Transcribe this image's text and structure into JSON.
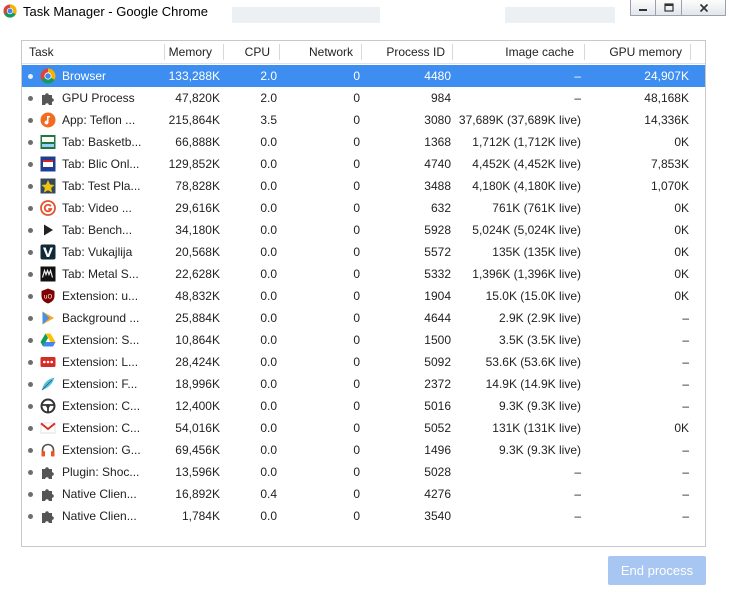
{
  "window": {
    "title": "Task Manager - Google Chrome"
  },
  "columns": [
    "Task",
    "Memory",
    "CPU",
    "Network",
    "Process ID",
    "Image cache",
    "GPU memory"
  ],
  "rows": [
    {
      "icon": "chrome-icon",
      "task": "Browser",
      "memory": "133,288K",
      "cpu": "2.0",
      "network": "0",
      "pid": "4480",
      "image_cache": "–",
      "gpu": "24,907K",
      "selected": true
    },
    {
      "icon": "puzzle-icon",
      "task": "GPU Process",
      "memory": "47,820K",
      "cpu": "2.0",
      "network": "0",
      "pid": "984",
      "image_cache": "–",
      "gpu": "48,168K"
    },
    {
      "icon": "teflon-app-icon",
      "task": "App: Teflon ...",
      "memory": "215,864K",
      "cpu": "3.5",
      "network": "0",
      "pid": "3080",
      "image_cache": "37,689K (37,689K live)",
      "gpu": "14,336K"
    },
    {
      "icon": "basketball-favicon",
      "task": "Tab: Basketb...",
      "memory": "66,888K",
      "cpu": "0.0",
      "network": "0",
      "pid": "1368",
      "image_cache": "1,712K (1,712K live)",
      "gpu": "0K"
    },
    {
      "icon": "blic-favicon",
      "task": "Tab: Blic Onl...",
      "memory": "129,852K",
      "cpu": "0.0",
      "network": "0",
      "pid": "4740",
      "image_cache": "4,452K (4,452K live)",
      "gpu": "7,853K"
    },
    {
      "icon": "test-favicon",
      "task": "Tab: Test Pla...",
      "memory": "78,828K",
      "cpu": "0.0",
      "network": "0",
      "pid": "3488",
      "image_cache": "4,180K (4,180K live)",
      "gpu": "1,070K"
    },
    {
      "icon": "video-favicon",
      "task": "Tab: Video ...",
      "memory": "29,616K",
      "cpu": "0.0",
      "network": "0",
      "pid": "632",
      "image_cache": "761K (761K live)",
      "gpu": "0K"
    },
    {
      "icon": "bench-favicon",
      "task": "Tab: Bench...",
      "memory": "34,180K",
      "cpu": "0.0",
      "network": "0",
      "pid": "5928",
      "image_cache": "5,024K (5,024K live)",
      "gpu": "0K"
    },
    {
      "icon": "vukajlija-favicon",
      "task": "Tab: Vukajlija",
      "memory": "20,568K",
      "cpu": "0.0",
      "network": "0",
      "pid": "5572",
      "image_cache": "135K (135K live)",
      "gpu": "0K"
    },
    {
      "icon": "metal-favicon",
      "task": "Tab: Metal S...",
      "memory": "22,628K",
      "cpu": "0.0",
      "network": "0",
      "pid": "5332",
      "image_cache": "1,396K (1,396K live)",
      "gpu": "0K"
    },
    {
      "icon": "ublock-icon",
      "task": "Extension: u...",
      "memory": "48,832K",
      "cpu": "0.0",
      "network": "0",
      "pid": "1904",
      "image_cache": "15.0K (15.0K live)",
      "gpu": "0K"
    },
    {
      "icon": "play-icon",
      "task": "Background ...",
      "memory": "25,884K",
      "cpu": "0.0",
      "network": "0",
      "pid": "4644",
      "image_cache": "2.9K (2.9K live)",
      "gpu": "–"
    },
    {
      "icon": "drive-icon",
      "task": "Extension: S...",
      "memory": "10,864K",
      "cpu": "0.0",
      "network": "0",
      "pid": "1500",
      "image_cache": "3.5K (3.5K live)",
      "gpu": "–"
    },
    {
      "icon": "lastpass-icon",
      "task": "Extension: L...",
      "memory": "28,424K",
      "cpu": "0.0",
      "network": "0",
      "pid": "5092",
      "image_cache": "53.6K (53.6K live)",
      "gpu": "–"
    },
    {
      "icon": "feather-icon",
      "task": "Extension: F...",
      "memory": "18,996K",
      "cpu": "0.0",
      "network": "0",
      "pid": "2372",
      "image_cache": "14.9K (14.9K live)",
      "gpu": "–"
    },
    {
      "icon": "steering-wheel-icon",
      "task": "Extension: C...",
      "memory": "12,400K",
      "cpu": "0.0",
      "network": "0",
      "pid": "5016",
      "image_cache": "9.3K (9.3K live)",
      "gpu": "–"
    },
    {
      "icon": "gmail-icon",
      "task": "Extension: C...",
      "memory": "54,016K",
      "cpu": "0.0",
      "network": "0",
      "pid": "5052",
      "image_cache": "131K (131K live)",
      "gpu": "0K"
    },
    {
      "icon": "headphones-icon",
      "task": "Extension: G...",
      "memory": "69,456K",
      "cpu": "0.0",
      "network": "0",
      "pid": "1496",
      "image_cache": "9.3K (9.3K live)",
      "gpu": "–"
    },
    {
      "icon": "puzzle-icon",
      "task": "Plugin: Shoc...",
      "memory": "13,596K",
      "cpu": "0.0",
      "network": "0",
      "pid": "5028",
      "image_cache": "–",
      "gpu": "–"
    },
    {
      "icon": "puzzle-icon",
      "task": "Native Clien...",
      "memory": "16,892K",
      "cpu": "0.4",
      "network": "0",
      "pid": "4276",
      "image_cache": "–",
      "gpu": "–"
    },
    {
      "icon": "puzzle-icon",
      "task": "Native Clien...",
      "memory": "1,784K",
      "cpu": "0.0",
      "network": "0",
      "pid": "3540",
      "image_cache": "–",
      "gpu": "–"
    }
  ],
  "buttons": {
    "end_process": "End process"
  },
  "colors": {
    "selection": "#3d8ef0",
    "button_disabled": "#a7c6f2",
    "border": "#c8c8c8"
  }
}
